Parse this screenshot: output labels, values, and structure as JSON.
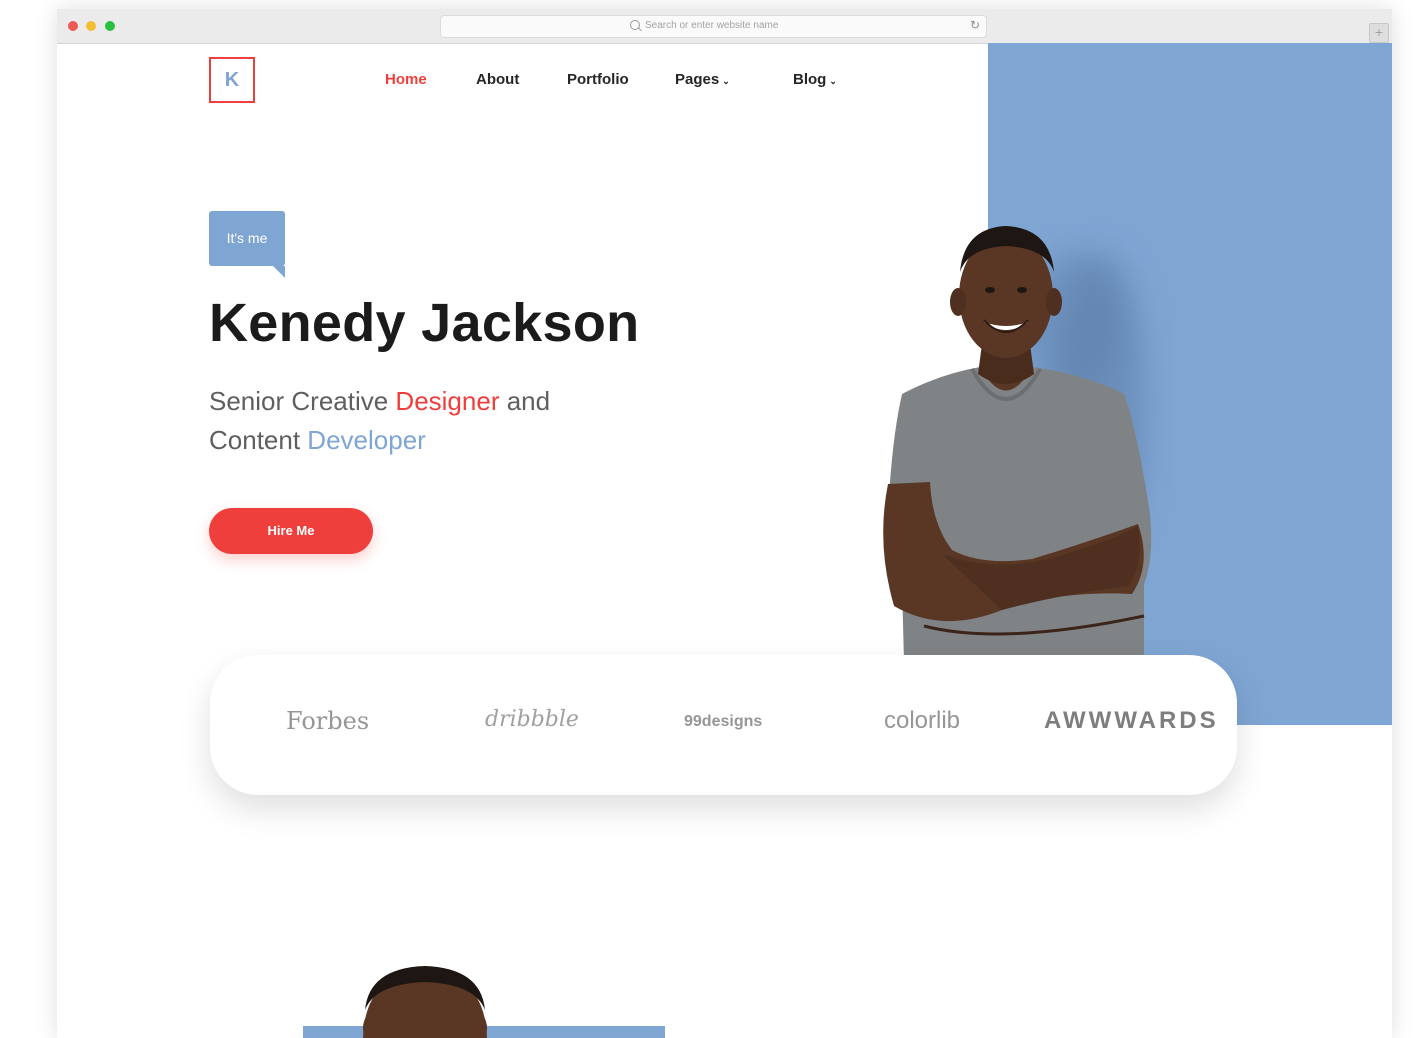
{
  "browser": {
    "address_placeholder": "Search or enter website name",
    "reload_icon": "reload-icon",
    "new_tab_symbol": "+"
  },
  "logo": {
    "letter": "K"
  },
  "nav": {
    "items": [
      {
        "label": "Home",
        "active": true
      },
      {
        "label": "About",
        "active": false
      },
      {
        "label": "Portfolio",
        "active": false
      },
      {
        "label": "Pages",
        "dropdown": true
      },
      {
        "label": "Blog",
        "dropdown": true
      }
    ],
    "chevron": "⌄"
  },
  "hero": {
    "badge": "It's me",
    "name": "Kenedy Jackson",
    "line1_a": "Senior Creative ",
    "line1_b": "Designer",
    "line1_c": " and",
    "line2_a": "Content ",
    "line2_b": "Developer",
    "button": "Hire Me"
  },
  "brands": [
    "Forbes",
    "dribbble",
    "99designs",
    "colorlib",
    "AWWWARDS"
  ],
  "colors": {
    "accent_red": "#ee3f3c",
    "accent_blue": "#7fa5d3",
    "heading": "#1b1b1b"
  }
}
